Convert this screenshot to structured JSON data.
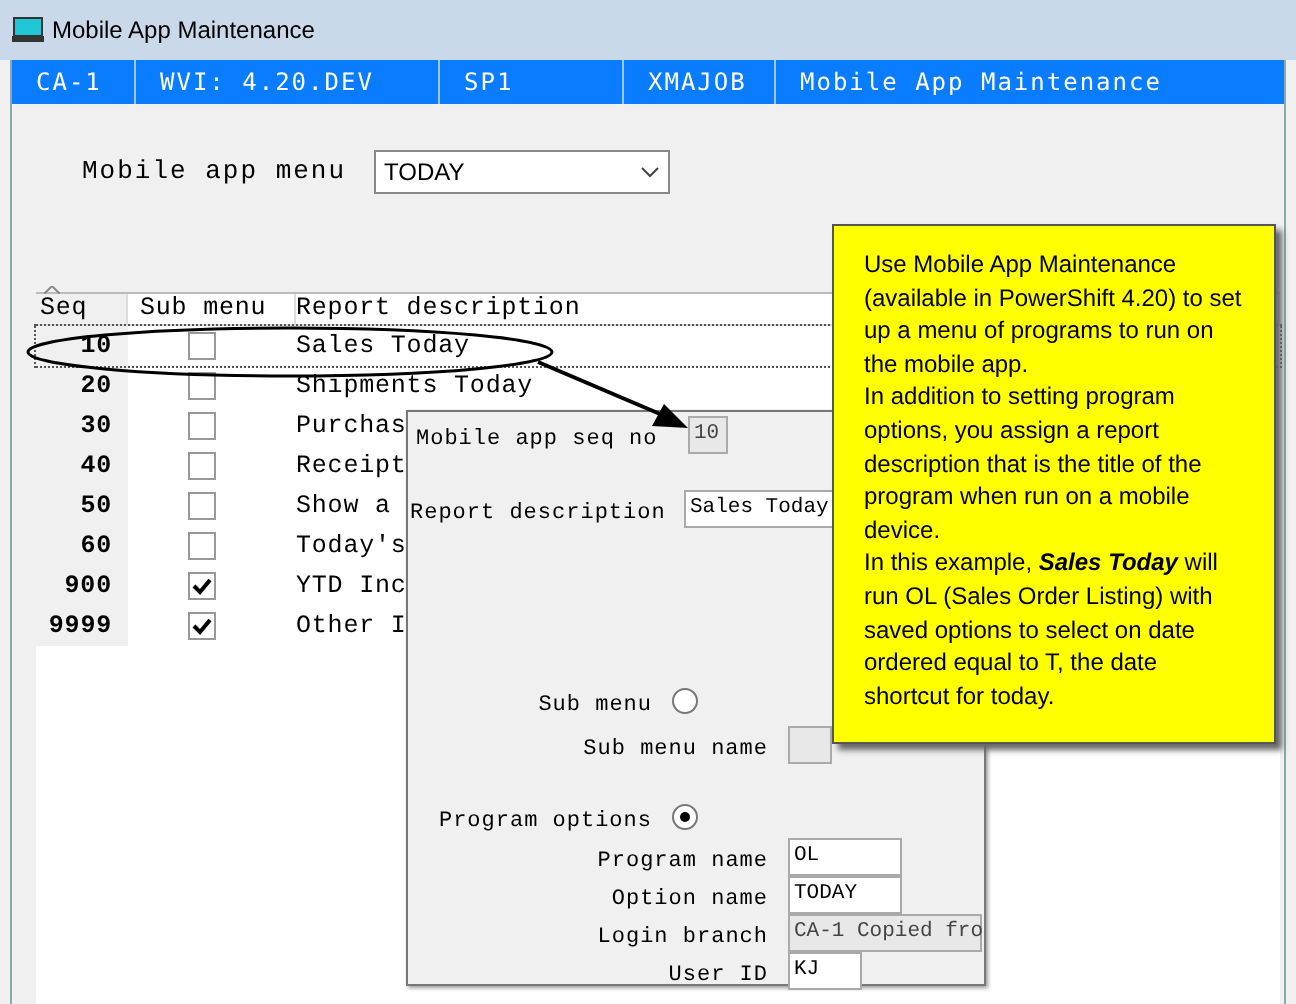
{
  "window": {
    "title": "Mobile App Maintenance"
  },
  "header_bar": [
    "CA-1",
    "WVI: 4.20.DEV",
    "SP1",
    "XMAJOB",
    "Mobile App Maintenance"
  ],
  "menu_selector": {
    "label": "Mobile app menu",
    "value": "TODAY"
  },
  "table": {
    "columns": [
      "Seq",
      "Sub menu",
      "Report description"
    ],
    "rows": [
      {
        "seq": "10",
        "sub_menu": false,
        "description": "Sales Today",
        "selected": true
      },
      {
        "seq": "20",
        "sub_menu": false,
        "description": "Shipments Today",
        "selected": false
      },
      {
        "seq": "30",
        "sub_menu": false,
        "description": "Purchas",
        "selected": false
      },
      {
        "seq": "40",
        "sub_menu": false,
        "description": "Receipt",
        "selected": false
      },
      {
        "seq": "50",
        "sub_menu": false,
        "description": "Show a",
        "selected": false
      },
      {
        "seq": "60",
        "sub_menu": false,
        "description": "Today's",
        "selected": false
      },
      {
        "seq": "900",
        "sub_menu": true,
        "description": "YTD Inc",
        "selected": false
      },
      {
        "seq": "9999",
        "sub_menu": true,
        "description": "Other I",
        "selected": false
      }
    ]
  },
  "detail_dialog": {
    "rows": [
      {
        "kind": "field",
        "label": "Mobile app seq no",
        "value": "10",
        "disabled": true
      },
      {
        "kind": "field",
        "label": "Report description",
        "value": "Sales Today",
        "disabled": false
      },
      {
        "kind": "radio",
        "label": "Sub menu",
        "selected": false
      },
      {
        "kind": "field",
        "label": "Sub menu name",
        "disabled": true
      },
      {
        "kind": "radio",
        "label": "Program options",
        "selected": true
      },
      {
        "kind": "field",
        "label": "Program name",
        "value": "OL",
        "disabled": false
      },
      {
        "kind": "field",
        "label": "Option name",
        "value": "TODAY",
        "disabled": false
      },
      {
        "kind": "field",
        "label": "Login branch",
        "value": "CA-1 Copied fro",
        "disabled": true
      },
      {
        "kind": "field",
        "label": "User ID",
        "value": "KJ",
        "disabled": false
      }
    ]
  },
  "callout": {
    "paragraphs": [
      "Use Mobile App Maintenance (available in PowerShift 4.20) to set up a menu of programs to run on the mobile app.",
      "In addition to setting program options, you assign a report description that is the title of the program when run on a mobile device.",
      "In this example, *Sales Today* will run OL (Sales Order Listing) with saved options to select on date ordered equal to T, the date shortcut for today."
    ]
  }
}
